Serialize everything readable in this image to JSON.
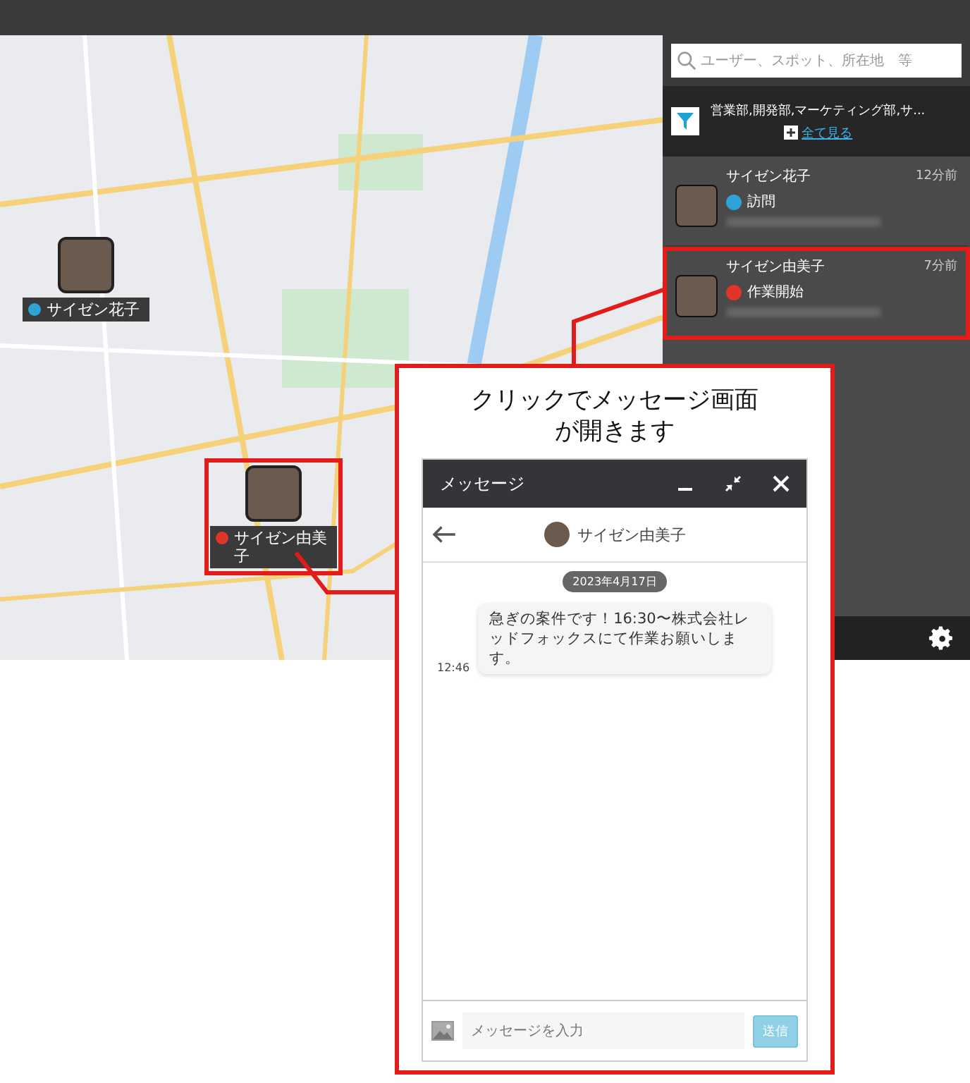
{
  "search": {
    "placeholder": "ユーザー、スポット、所在地　等"
  },
  "filter": {
    "text": "営業部,開発部,マーケティング部,サ...",
    "link": "全て見る"
  },
  "users": [
    {
      "name": "サイゼン花子",
      "time": "12分前",
      "status": "訪問",
      "color": "#2fa3d6",
      "highlighted": false
    },
    {
      "name": "サイゼン由美子",
      "time": "7分前",
      "status": "作業開始",
      "color": "#e0352b",
      "highlighted": true
    }
  ],
  "map_markers": [
    {
      "name": "サイゼン花子",
      "color": "#2fa3d6",
      "highlighted": false
    },
    {
      "name": "サイゼン由美子",
      "color": "#e0352b",
      "highlighted": true
    }
  ],
  "callout": {
    "caption_lines": [
      "クリックでメッセージ画面",
      "が開きます"
    ]
  },
  "message_window": {
    "title": "メッセージ",
    "contact": "サイゼン由美子",
    "date": "2023年4月17日",
    "messages": [
      {
        "text": "急ぎの案件です！16:30〜株式会社レッドフォックスにて作業お願いします。",
        "time": "12:46"
      }
    ],
    "input": {
      "placeholder": "メッセージを入力"
    },
    "send": {
      "label": "送信",
      "disabled": true
    }
  }
}
